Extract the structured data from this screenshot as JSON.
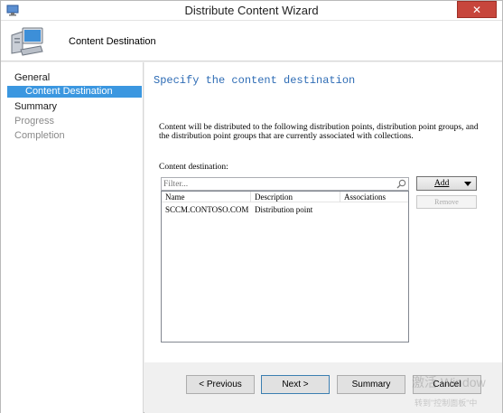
{
  "window": {
    "title": "Distribute Content Wizard",
    "close_label": "✕"
  },
  "header": {
    "title": "Content Destination",
    "icon": "computer-monitor-icon"
  },
  "nav": {
    "items": [
      {
        "label": "General",
        "state": "normal"
      },
      {
        "label": "Content Destination",
        "state": "selected"
      },
      {
        "label": "Summary",
        "state": "normal"
      },
      {
        "label": "Progress",
        "state": "disabled"
      },
      {
        "label": "Completion",
        "state": "disabled"
      }
    ]
  },
  "main": {
    "heading": "Specify the content destination",
    "description": "Content will be distributed to the following distribution points, distribution point groups, and the distribution point groups that are currently associated with collections.",
    "destination_label": "Content destination:",
    "filter_placeholder": "Filter...",
    "filter_icon": "search-icon",
    "add_label": "Add",
    "remove_label": "Remove",
    "table": {
      "columns": [
        "Name",
        "Description",
        "Associations"
      ],
      "rows": [
        [
          "SCCM.CONTOSO.COM",
          "Distribution point",
          ""
        ]
      ]
    }
  },
  "footer": {
    "previous_label": "< Previous",
    "next_label": "Next >",
    "summary_label": "Summary",
    "cancel_label": "Cancel"
  },
  "overlay": {
    "watermark_line1": "激活 Window",
    "watermark_line2": "转到\"控制面板\"中"
  },
  "colors": {
    "accent": "#3b97e0",
    "heading": "#2e6cb5",
    "close": "#c7463c"
  }
}
